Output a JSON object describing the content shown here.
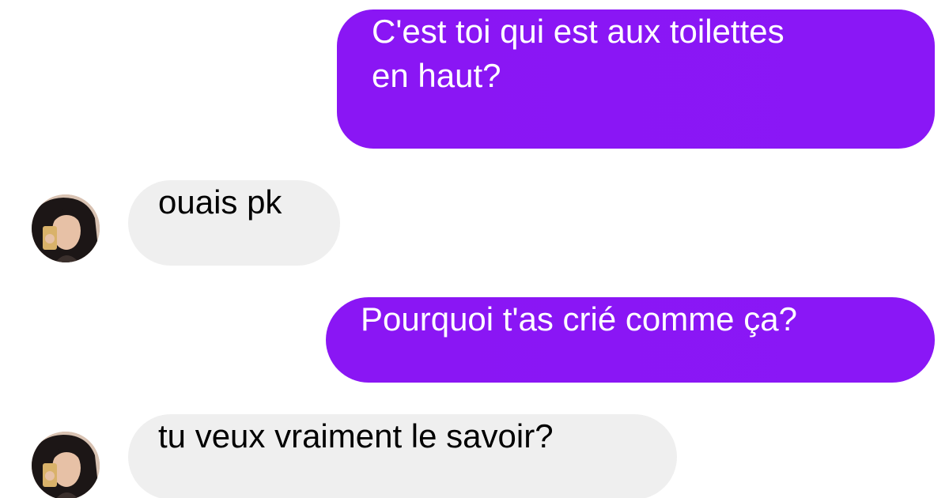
{
  "conversation": {
    "messages": [
      {
        "direction": "outgoing",
        "lines": [
          "C'est toi qui est aux toilettes",
          "en haut?"
        ]
      },
      {
        "direction": "incoming",
        "text": "ouais pk"
      },
      {
        "direction": "outgoing",
        "text": "Pourquoi t'as crié comme ça?"
      },
      {
        "direction": "incoming",
        "text": "tu veux vraiment le savoir?"
      }
    ]
  },
  "colors": {
    "outgoing_bubble": "#8a16f4",
    "incoming_bubble": "#efefef",
    "background": "#ffffff"
  },
  "icons": {
    "contact_avatar": "contact-avatar"
  }
}
